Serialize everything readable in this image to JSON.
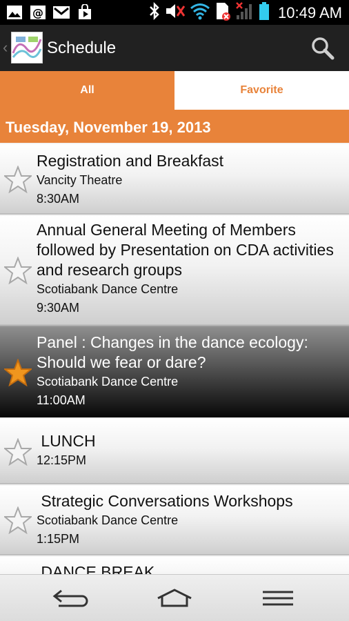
{
  "status_bar": {
    "time": "10:49 AM",
    "left_icons": [
      "image-icon",
      "at-sign-icon",
      "gmail-icon",
      "play-store-icon"
    ],
    "right_icons": [
      "bluetooth-icon",
      "mute-icon",
      "wifi-icon",
      "sim-error-icon",
      "signal-icon",
      "battery-icon"
    ]
  },
  "action_bar": {
    "title": "Schedule",
    "logo_icon": "app-logo-icon",
    "search_icon": "search-icon"
  },
  "tabs": [
    {
      "label": "All",
      "active": true
    },
    {
      "label": "Favorite",
      "active": false
    }
  ],
  "date_header": "Tuesday, November 19, 2013",
  "items": [
    {
      "title": "Registration and Breakfast",
      "location": "Vancity Theatre",
      "time": "8:30AM",
      "favorite": false
    },
    {
      "title": "Annual General Meeting of Members followed by Presentation on CDA activities and research groups",
      "location": "Scotiabank Dance Centre",
      "time": "9:30AM",
      "favorite": false
    },
    {
      "title": "Panel : Changes in the dance ecology: Should we fear or dare?",
      "location": "Scotiabank Dance Centre",
      "time": "11:00AM",
      "favorite": true
    },
    {
      "title": " LUNCH",
      "location": "",
      "time": "12:15PM",
      "favorite": false
    },
    {
      "title": " Strategic Conversations Workshops",
      "location": "Scotiabank Dance Centre",
      "time": "1:15PM",
      "favorite": false
    },
    {
      "title": " DANCE BREAK",
      "location": "",
      "time": "",
      "favorite": false
    }
  ],
  "colors": {
    "accent": "#e8833a",
    "actionbar": "#212121",
    "star_active": "#f0961e"
  },
  "nav_bar": {
    "icons": [
      "back-icon",
      "home-icon",
      "menu-icon"
    ]
  }
}
